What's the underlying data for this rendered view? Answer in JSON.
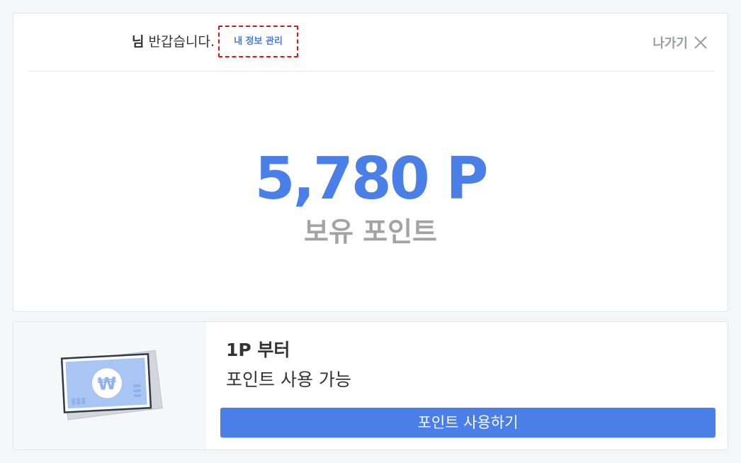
{
  "header": {
    "greeting_suffix": "님",
    "greeting_text": " 반갑습니다.",
    "manage_label": "내 정보 관리",
    "exit_label": "나가기"
  },
  "points": {
    "value": "5,780 P",
    "label": "보유 포인트"
  },
  "use_panel": {
    "title": "1P 부터",
    "subtitle": "포인트 사용 가능",
    "button_label": "포인트 사용하기",
    "illustration_icon": "money-bill-won-icon",
    "currency_symbol": "₩"
  },
  "colors": {
    "accent": "#4a7fe8",
    "highlight_border": "#d9161b",
    "muted_text": "#a3a3a3"
  }
}
